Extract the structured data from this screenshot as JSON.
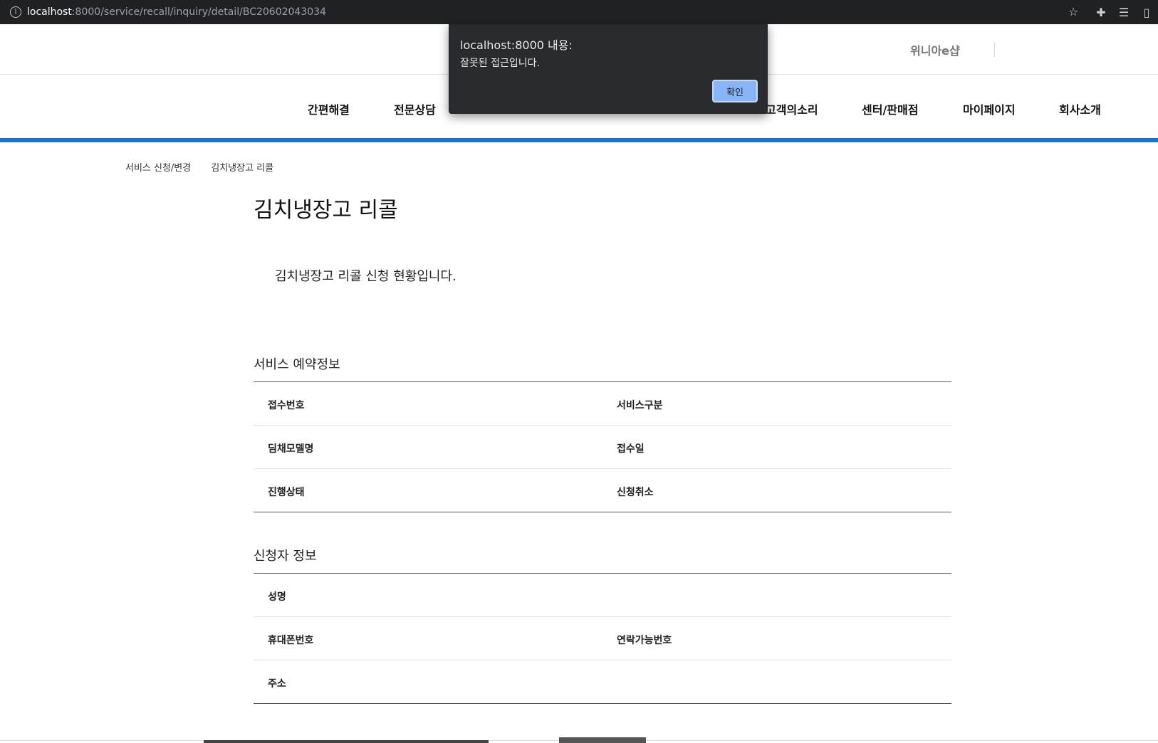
{
  "browser": {
    "url_host": "localhost",
    "url_rest": ":8000/service/recall/inquiry/detail/BC20602043034"
  },
  "header": {
    "shop_link": "위니아e샵"
  },
  "gnb": {
    "items": [
      "간편해결",
      "전문상담",
      "고객의소리",
      "센터/판매점",
      "마이페이지",
      "회사소개"
    ]
  },
  "breadcrumb": [
    "서비스 신청/변경",
    "김치냉장고 리콜"
  ],
  "page": {
    "title": "김치냉장고 리콜",
    "intro": "김치냉장고 리콜 신청 현황입니다."
  },
  "service_info": {
    "title": "서비스 예약정보",
    "rows": [
      {
        "left": "접수번호",
        "right": "서비스구분"
      },
      {
        "left": "딤채모델명",
        "right": "접수일"
      },
      {
        "left": "진행상태",
        "right": "신청취소"
      }
    ]
  },
  "applicant_info": {
    "title": "신청자 정보",
    "rows": [
      {
        "left": "성명",
        "right": ""
      },
      {
        "left": "휴대폰번호",
        "right": "연락가능번호"
      },
      {
        "left": "주소",
        "right": ""
      }
    ]
  },
  "alert": {
    "title": "localhost:8000 내용:",
    "message": "잘못된 접근입니다.",
    "ok_label": "확인"
  }
}
